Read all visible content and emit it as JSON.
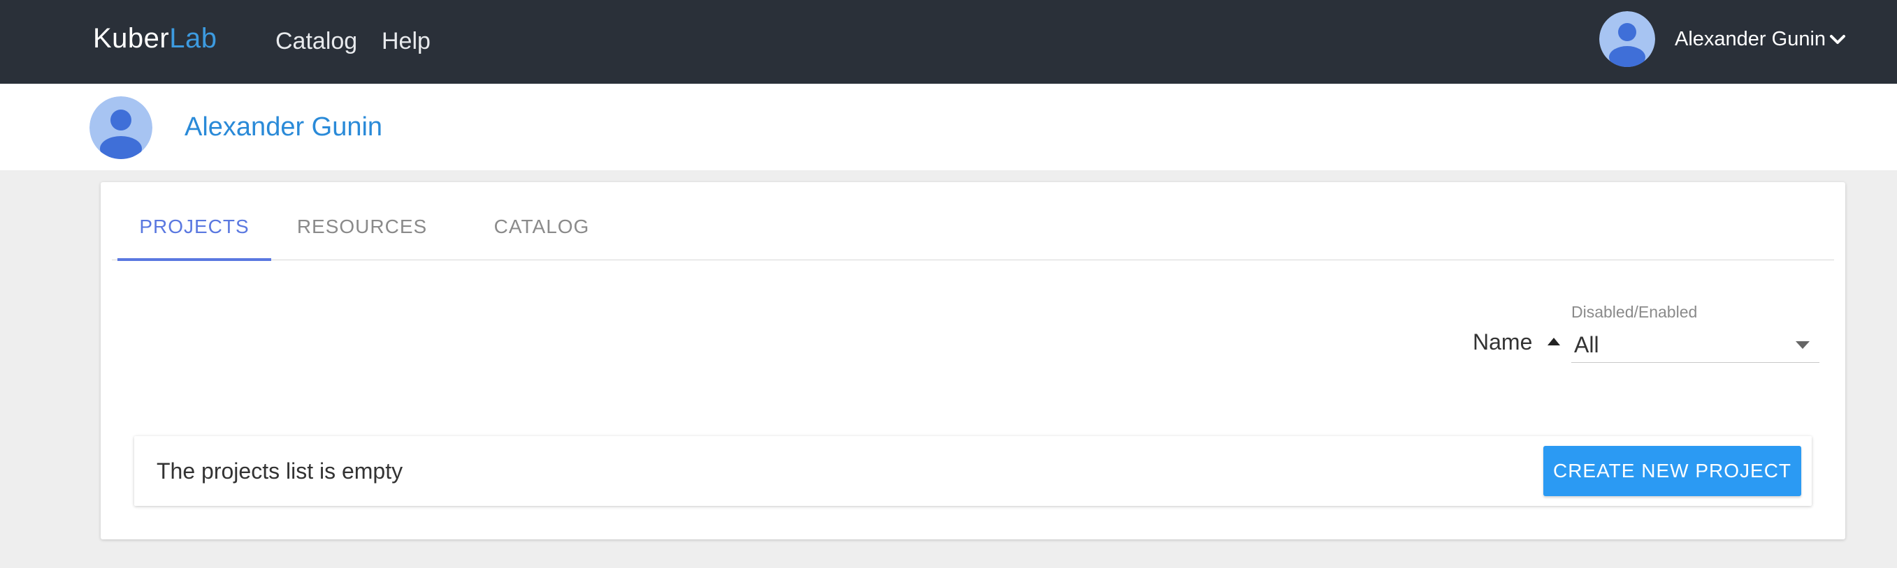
{
  "header": {
    "logo_part1": "Kuber",
    "logo_part2": "Lab",
    "nav": {
      "catalog": "Catalog",
      "help": "Help"
    },
    "user_name": "Alexander Gunin",
    "user_menu_icon": "chevron-down-icon"
  },
  "profile": {
    "name": "Alexander Gunin",
    "avatar_icon": "user-avatar-icon"
  },
  "tabs": [
    {
      "label": "PROJECTS",
      "active": true
    },
    {
      "label": "RESOURCES",
      "active": false
    },
    {
      "label": "CATALOG",
      "active": false
    }
  ],
  "controls": {
    "sort_label": "Name",
    "sort_direction": "ascending",
    "filter_label": "Disabled/Enabled",
    "filter_value": "All"
  },
  "projects": {
    "empty_message": "The projects list is empty",
    "create_button": "CREATE NEW PROJECT"
  },
  "colors": {
    "topbar": "#2a3039",
    "logo_accent": "#3d9be0",
    "profile_name": "#2a8ad8",
    "active_tab": "#5a78e0",
    "primary_button": "#2b9af3",
    "avatar_bg": "#a7c4f2",
    "avatar_fg": "#3f6fd8"
  }
}
